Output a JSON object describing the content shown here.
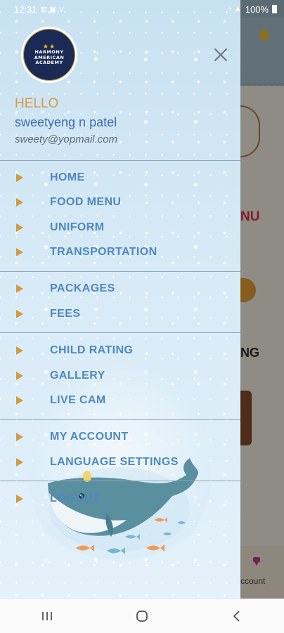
{
  "status_bar": {
    "time": "12:31",
    "battery": "100%"
  },
  "drawer": {
    "logo": {
      "line1": "HARMONY",
      "line2": "AMERICAN",
      "line3": "ACADEMY"
    },
    "greeting": "HELLO",
    "user_name": "sweetyeng n patel",
    "user_email": "sweety@yopmail.com",
    "menu_groups": [
      {
        "items": [
          {
            "label": "HOME"
          },
          {
            "label": "FOOD MENU"
          },
          {
            "label": "UNIFORM"
          },
          {
            "label": "TRANSPORTATION"
          }
        ]
      },
      {
        "items": [
          {
            "label": "PACKAGES"
          },
          {
            "label": "FEES"
          }
        ]
      },
      {
        "items": [
          {
            "label": "CHILD RATING"
          },
          {
            "label": "GALLERY"
          },
          {
            "label": "LIVE CAM"
          }
        ]
      },
      {
        "items": [
          {
            "label": "MY ACCOUNT"
          },
          {
            "label": "LANGUAGE SETTINGS"
          }
        ]
      },
      {
        "items": [
          {
            "label": "LOGOUT"
          }
        ]
      }
    ]
  },
  "background": {
    "partial_text_1": "NU",
    "partial_text_2": "NG",
    "bottom_tab_label": "ccount"
  },
  "colors": {
    "menu_label": "#4f88bd",
    "menu_arrow": "#d49a3f",
    "greeting": "#d79a45",
    "user_name": "#3d6ea6"
  }
}
